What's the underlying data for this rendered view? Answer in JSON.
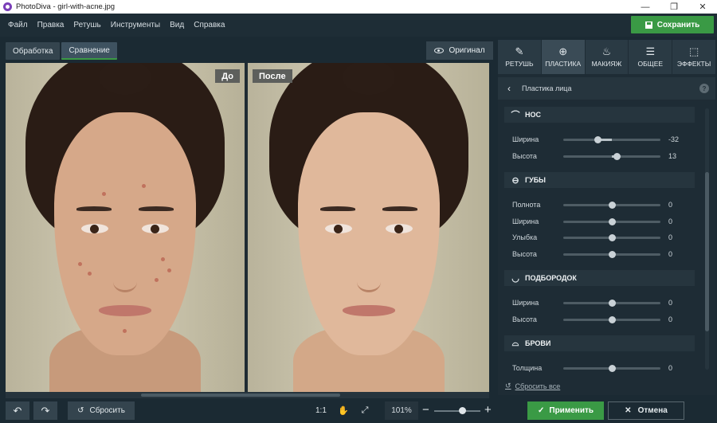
{
  "window": {
    "title": "PhotoDiva - girl-with-acne.jpg",
    "minimize": "—",
    "maximize": "❐",
    "close": "✕"
  },
  "menu": [
    "Файл",
    "Правка",
    "Ретушь",
    "Инструменты",
    "Вид",
    "Справка"
  ],
  "save_label": "Сохранить",
  "view_tabs": {
    "process": "Обработка",
    "compare": "Сравнение"
  },
  "original_label": "Оригинал",
  "compare": {
    "before": "До",
    "after": "После"
  },
  "panel_tabs": [
    {
      "label": "РЕТУШЬ",
      "icon": "✎"
    },
    {
      "label": "ПЛАСТИКА",
      "icon": "⊕"
    },
    {
      "label": "МАКИЯЖ",
      "icon": "♨"
    },
    {
      "label": "ОБЩЕЕ",
      "icon": "☰"
    },
    {
      "label": "ЭФФЕКТЫ",
      "icon": "⬚"
    }
  ],
  "panel_title": "Пластика лица",
  "help": "?",
  "sections": {
    "nose": {
      "title": "НОС",
      "icon": "⌒",
      "rows": [
        {
          "label": "Ширина",
          "value": "-32",
          "fraction": 0.36
        },
        {
          "label": "Высота",
          "value": "13",
          "fraction": 0.55
        }
      ]
    },
    "lips": {
      "title": "ГУБЫ",
      "icon": "⊖",
      "rows": [
        {
          "label": "Полнота",
          "value": "0",
          "fraction": 0.5
        },
        {
          "label": "Ширина",
          "value": "0",
          "fraction": 0.5
        },
        {
          "label": "Улыбка",
          "value": "0",
          "fraction": 0.5
        },
        {
          "label": "Высота",
          "value": "0",
          "fraction": 0.5
        }
      ]
    },
    "chin": {
      "title": "ПОДБОРОДОК",
      "icon": "◡",
      "rows": [
        {
          "label": "Ширина",
          "value": "0",
          "fraction": 0.5
        },
        {
          "label": "Высота",
          "value": "0",
          "fraction": 0.5
        }
      ]
    },
    "brows": {
      "title": "БРОВИ",
      "icon": "⌓",
      "rows": [
        {
          "label": "Толщина",
          "value": "0",
          "fraction": 0.5
        }
      ]
    }
  },
  "reset_all": "Сбросить все",
  "bottom": {
    "reset": "Сбросить",
    "ratio": "1:1",
    "zoom": "101%",
    "zoom_fraction": 0.62,
    "apply": "Применить",
    "cancel": "Отмена"
  }
}
